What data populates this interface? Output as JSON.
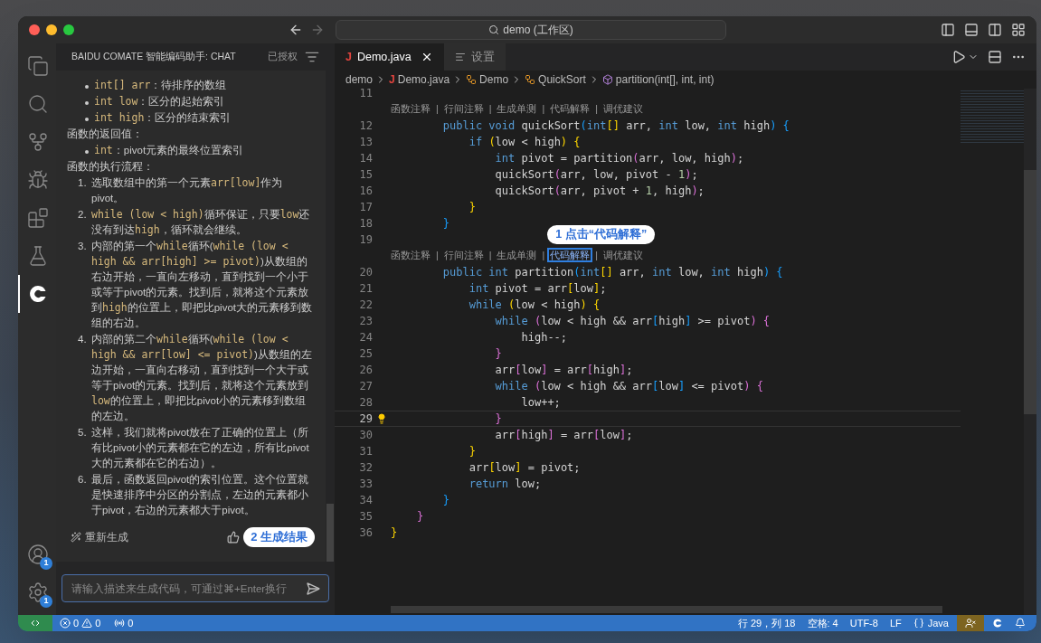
{
  "window": {
    "search": "demo (工作区)"
  },
  "activity_bar": {
    "items": [
      {
        "kind": "files",
        "selected": false
      },
      {
        "kind": "search",
        "selected": false
      },
      {
        "kind": "scm",
        "selected": false
      },
      {
        "kind": "debug",
        "selected": false
      },
      {
        "kind": "extensions",
        "selected": false
      },
      {
        "kind": "testing",
        "selected": false
      },
      {
        "kind": "comate",
        "selected": true
      }
    ],
    "bottom": [
      {
        "kind": "account",
        "badge": "1"
      },
      {
        "kind": "settings",
        "badge": "1"
      }
    ]
  },
  "chat": {
    "title": "BAIDU COMATE 智能编码助手: CHAT",
    "status": "已授权",
    "blocks": [
      {
        "kind": "bullet",
        "segments": [
          {
            "text": "int[] arr",
            "kind": "code"
          },
          {
            "text": "：待排序的数组",
            "kind": "text"
          }
        ]
      },
      {
        "kind": "bullet",
        "segments": [
          {
            "text": "int low",
            "kind": "code"
          },
          {
            "text": "：区分的起始索引",
            "kind": "text"
          }
        ]
      },
      {
        "kind": "bullet",
        "segments": [
          {
            "text": "int high",
            "kind": "code"
          },
          {
            "text": "：区分的结束索引",
            "kind": "text"
          }
        ]
      },
      {
        "kind": "heading",
        "segments": [
          {
            "text": "函数的返回值：",
            "kind": "text"
          }
        ]
      },
      {
        "kind": "bullet",
        "segments": [
          {
            "text": "int",
            "kind": "code"
          },
          {
            "text": "：pivot元素的最终位置索引",
            "kind": "text"
          }
        ]
      },
      {
        "kind": "heading",
        "segments": [
          {
            "text": "函数的执行流程：",
            "kind": "text"
          }
        ]
      },
      {
        "kind": "numbered",
        "number": "1.",
        "segments": [
          {
            "text": "选取数组中的第一个元素",
            "kind": "text"
          },
          {
            "text": "arr[low]",
            "kind": "code"
          },
          {
            "text": "作为pivot。",
            "kind": "text"
          }
        ]
      },
      {
        "kind": "numbered",
        "number": "2.",
        "segments": [
          {
            "text": "while (low < high)",
            "kind": "code"
          },
          {
            "text": "循环保证，只要",
            "kind": "text"
          },
          {
            "text": "low",
            "kind": "code"
          },
          {
            "text": "还没有到达",
            "kind": "text"
          },
          {
            "text": "high",
            "kind": "code"
          },
          {
            "text": "，循环就会继续。",
            "kind": "text"
          }
        ]
      },
      {
        "kind": "numbered",
        "number": "3.",
        "segments": [
          {
            "text": "内部的第一个",
            "kind": "text"
          },
          {
            "text": "while",
            "kind": "code"
          },
          {
            "text": "循环(",
            "kind": "text"
          },
          {
            "text": "while (low < high && arr[high] >= pivot)",
            "kind": "code"
          },
          {
            "text": ")从数组的右边开始，一直向左移动，直到找到一个小于或等于pivot的元素。找到后，就将这个元素放到",
            "kind": "text"
          },
          {
            "text": "high",
            "kind": "code"
          },
          {
            "text": "的位置上，即把比pivot大的元素移到数组的右边。",
            "kind": "text"
          }
        ]
      },
      {
        "kind": "numbered",
        "number": "4.",
        "segments": [
          {
            "text": "内部的第二个",
            "kind": "text"
          },
          {
            "text": "while",
            "kind": "code"
          },
          {
            "text": "循环(",
            "kind": "text"
          },
          {
            "text": "while (low < high && arr[low] <= pivot)",
            "kind": "code"
          },
          {
            "text": ")从数组的左边开始，一直向右移动，直到找到一个大于或等于pivot的元素。找到后，就将这个元素放到",
            "kind": "text"
          },
          {
            "text": "low",
            "kind": "code"
          },
          {
            "text": "的位置上，即把比pivot小的元素移到数组的左边。",
            "kind": "text"
          }
        ]
      },
      {
        "kind": "numbered",
        "number": "5.",
        "segments": [
          {
            "text": "这样，我们就将pivot放在了正确的位置上（所有比pivot小的元素都在它的左边，所有比pivot大的元素都在它的右边）。",
            "kind": "text"
          }
        ]
      },
      {
        "kind": "numbered",
        "number": "6.",
        "segments": [
          {
            "text": "最后，函数返回pivot的索引位置。这个位置就是快速排序中分区的分割点，左边的元素都小于pivot，右边的元素都大于pivot。",
            "kind": "text"
          }
        ]
      }
    ],
    "regenerate": "重新生成",
    "callout": "2 生成结果",
    "input": {
      "placeholder": "请输入描述来生成代码，可通过⌘+Enter换行"
    }
  },
  "editor": {
    "tabs": [
      {
        "label": "Demo.java",
        "icon_letter": "J",
        "kind": "java",
        "selected": true
      },
      {
        "label": "设置",
        "kind": "settings",
        "selected": false
      }
    ],
    "breadcrumb": [
      {
        "label": "demo",
        "kind": "folder"
      },
      {
        "label": "Demo.java",
        "kind": "java",
        "icon_letter": "J"
      },
      {
        "label": "Demo",
        "kind": "class"
      },
      {
        "label": "QuickSort",
        "kind": "class"
      },
      {
        "label": "partition(int[], int, int)",
        "kind": "method"
      }
    ],
    "separator": "|",
    "callout": "1 点击“代码解释”",
    "lines": [
      {
        "number": "11",
        "current": false
      },
      {
        "number": "12",
        "current": false,
        "codelens": [
          {
            "label": "函数注释",
            "highlighted": false
          },
          {
            "label": "行间注释",
            "highlighted": false
          },
          {
            "label": "生成单测",
            "highlighted": false
          },
          {
            "label": "代码解释",
            "highlighted": false
          },
          {
            "label": "调优建议",
            "highlighted": false
          }
        ],
        "tokens": [
          {
            "kind": "keyword",
            "text": "        public void"
          },
          {
            "kind": "plain",
            "text": " quickSort"
          },
          {
            "kind": "azure",
            "text": "("
          },
          {
            "kind": "keyword",
            "text": "int"
          },
          {
            "kind": "gold",
            "text": "[]"
          },
          {
            "kind": "plain",
            "text": " arr, "
          },
          {
            "kind": "keyword",
            "text": "int"
          },
          {
            "kind": "plain",
            "text": " low, "
          },
          {
            "kind": "keyword",
            "text": "int"
          },
          {
            "kind": "plain",
            "text": " high"
          },
          {
            "kind": "azure",
            "text": ") {"
          }
        ]
      },
      {
        "number": "13",
        "current": false,
        "tokens": [
          {
            "kind": "keyword",
            "text": "            if"
          },
          {
            "kind": "gold",
            "text": " ("
          },
          {
            "kind": "plain",
            "text": "low < high"
          },
          {
            "kind": "gold",
            "text": ") {"
          }
        ]
      },
      {
        "number": "14",
        "current": false,
        "tokens": [
          {
            "kind": "keyword",
            "text": "                int"
          },
          {
            "kind": "plain",
            "text": " pivot = partition"
          },
          {
            "kind": "orchid",
            "text": "("
          },
          {
            "kind": "plain",
            "text": "arr, low, high"
          },
          {
            "kind": "orchid",
            "text": ")"
          },
          {
            "kind": "plain",
            "text": ";"
          }
        ]
      },
      {
        "number": "15",
        "current": false,
        "tokens": [
          {
            "kind": "plain",
            "text": "                quickSort"
          },
          {
            "kind": "orchid",
            "text": "("
          },
          {
            "kind": "plain",
            "text": "arr, low, pivot - "
          },
          {
            "kind": "number",
            "text": "1"
          },
          {
            "kind": "orchid",
            "text": ")"
          },
          {
            "kind": "plain",
            "text": ";"
          }
        ]
      },
      {
        "number": "16",
        "current": false,
        "tokens": [
          {
            "kind": "plain",
            "text": "                quickSort"
          },
          {
            "kind": "orchid",
            "text": "("
          },
          {
            "kind": "plain",
            "text": "arr, pivot + "
          },
          {
            "kind": "number",
            "text": "1"
          },
          {
            "kind": "plain",
            "text": ", high"
          },
          {
            "kind": "orchid",
            "text": ")"
          },
          {
            "kind": "plain",
            "text": ";"
          }
        ]
      },
      {
        "number": "17",
        "current": false,
        "tokens": [
          {
            "kind": "gold",
            "text": "            }"
          }
        ]
      },
      {
        "number": "18",
        "current": false,
        "tokens": [
          {
            "kind": "azure",
            "text": "        }"
          }
        ]
      },
      {
        "number": "19",
        "current": false
      },
      {
        "number": "20",
        "current": false,
        "codelens": [
          {
            "label": "函数注释",
            "highlighted": false
          },
          {
            "label": "行间注释",
            "highlighted": false
          },
          {
            "label": "生成单测",
            "highlighted": false
          },
          {
            "label": "代码解释",
            "highlighted": true
          },
          {
            "label": "调优建议",
            "highlighted": false
          }
        ],
        "tokens": [
          {
            "kind": "keyword",
            "text": "        public int"
          },
          {
            "kind": "plain",
            "text": " partition"
          },
          {
            "kind": "azure",
            "text": "("
          },
          {
            "kind": "keyword",
            "text": "int"
          },
          {
            "kind": "gold",
            "text": "[]"
          },
          {
            "kind": "plain",
            "text": " arr, "
          },
          {
            "kind": "keyword",
            "text": "int"
          },
          {
            "kind": "plain",
            "text": " low, "
          },
          {
            "kind": "keyword",
            "text": "int"
          },
          {
            "kind": "plain",
            "text": " high"
          },
          {
            "kind": "azure",
            "text": ") {"
          }
        ]
      },
      {
        "number": "21",
        "current": false,
        "tokens": [
          {
            "kind": "keyword",
            "text": "            int"
          },
          {
            "kind": "plain",
            "text": " pivot = arr"
          },
          {
            "kind": "gold",
            "text": "["
          },
          {
            "kind": "plain",
            "text": "low"
          },
          {
            "kind": "gold",
            "text": "]"
          },
          {
            "kind": "plain",
            "text": ";"
          }
        ]
      },
      {
        "number": "22",
        "current": false,
        "tokens": [
          {
            "kind": "keyword",
            "text": "            while"
          },
          {
            "kind": "gold",
            "text": " ("
          },
          {
            "kind": "plain",
            "text": "low < high"
          },
          {
            "kind": "gold",
            "text": ") {"
          }
        ]
      },
      {
        "number": "23",
        "current": false,
        "tokens": [
          {
            "kind": "keyword",
            "text": "                while"
          },
          {
            "kind": "orchid",
            "text": " ("
          },
          {
            "kind": "plain",
            "text": "low < high && arr"
          },
          {
            "kind": "azure",
            "text": "["
          },
          {
            "kind": "plain",
            "text": "high"
          },
          {
            "kind": "azure",
            "text": "]"
          },
          {
            "kind": "plain",
            "text": " >= pivot"
          },
          {
            "kind": "orchid",
            "text": ") {"
          }
        ]
      },
      {
        "number": "24",
        "current": false,
        "tokens": [
          {
            "kind": "plain",
            "text": "                    high--;"
          }
        ]
      },
      {
        "number": "25",
        "current": false,
        "tokens": [
          {
            "kind": "orchid",
            "text": "                }"
          }
        ]
      },
      {
        "number": "26",
        "current": false,
        "tokens": [
          {
            "kind": "plain",
            "text": "                arr"
          },
          {
            "kind": "orchid",
            "text": "["
          },
          {
            "kind": "plain",
            "text": "low"
          },
          {
            "kind": "orchid",
            "text": "]"
          },
          {
            "kind": "plain",
            "text": " = arr"
          },
          {
            "kind": "orchid",
            "text": "["
          },
          {
            "kind": "plain",
            "text": "high"
          },
          {
            "kind": "orchid",
            "text": "]"
          },
          {
            "kind": "plain",
            "text": ";"
          }
        ]
      },
      {
        "number": "27",
        "current": false,
        "tokens": [
          {
            "kind": "keyword",
            "text": "                while"
          },
          {
            "kind": "orchid",
            "text": " ("
          },
          {
            "kind": "plain",
            "text": "low < high && arr"
          },
          {
            "kind": "azure",
            "text": "["
          },
          {
            "kind": "plain",
            "text": "low"
          },
          {
            "kind": "azure",
            "text": "]"
          },
          {
            "kind": "plain",
            "text": " <= pivot"
          },
          {
            "kind": "orchid",
            "text": ") {"
          }
        ]
      },
      {
        "number": "28",
        "current": false,
        "tokens": [
          {
            "kind": "plain",
            "text": "                    low++;"
          }
        ]
      },
      {
        "number": "29",
        "current": true,
        "tokens": [
          {
            "kind": "orchid",
            "text": "                }"
          }
        ]
      },
      {
        "number": "30",
        "current": false,
        "tokens": [
          {
            "kind": "plain",
            "text": "                arr"
          },
          {
            "kind": "orchid",
            "text": "["
          },
          {
            "kind": "plain",
            "text": "high"
          },
          {
            "kind": "orchid",
            "text": "]"
          },
          {
            "kind": "plain",
            "text": " = arr"
          },
          {
            "kind": "orchid",
            "text": "["
          },
          {
            "kind": "plain",
            "text": "low"
          },
          {
            "kind": "orchid",
            "text": "]"
          },
          {
            "kind": "plain",
            "text": ";"
          }
        ]
      },
      {
        "number": "31",
        "current": false,
        "tokens": [
          {
            "kind": "gold",
            "text": "            }"
          }
        ]
      },
      {
        "number": "32",
        "current": false,
        "tokens": [
          {
            "kind": "plain",
            "text": "            arr"
          },
          {
            "kind": "gold",
            "text": "["
          },
          {
            "kind": "plain",
            "text": "low"
          },
          {
            "kind": "gold",
            "text": "]"
          },
          {
            "kind": "plain",
            "text": " = pivot;"
          }
        ]
      },
      {
        "number": "33",
        "current": false,
        "tokens": [
          {
            "kind": "keyword",
            "text": "            return"
          },
          {
            "kind": "plain",
            "text": " low;"
          }
        ]
      },
      {
        "number": "34",
        "current": false,
        "tokens": [
          {
            "kind": "azure",
            "text": "        }"
          }
        ]
      },
      {
        "number": "35",
        "current": false,
        "tokens": [
          {
            "kind": "orchid",
            "text": "    }"
          }
        ]
      },
      {
        "number": "36",
        "current": false,
        "tokens": [
          {
            "kind": "gold",
            "text": "}"
          }
        ]
      }
    ]
  },
  "status_bar": {
    "errors": "0",
    "warnings": "0",
    "ports": "0",
    "position": "行 29，列 18",
    "indent": "空格: 4",
    "encoding": "UTF-8",
    "eol": "LF",
    "language": "Java"
  }
}
